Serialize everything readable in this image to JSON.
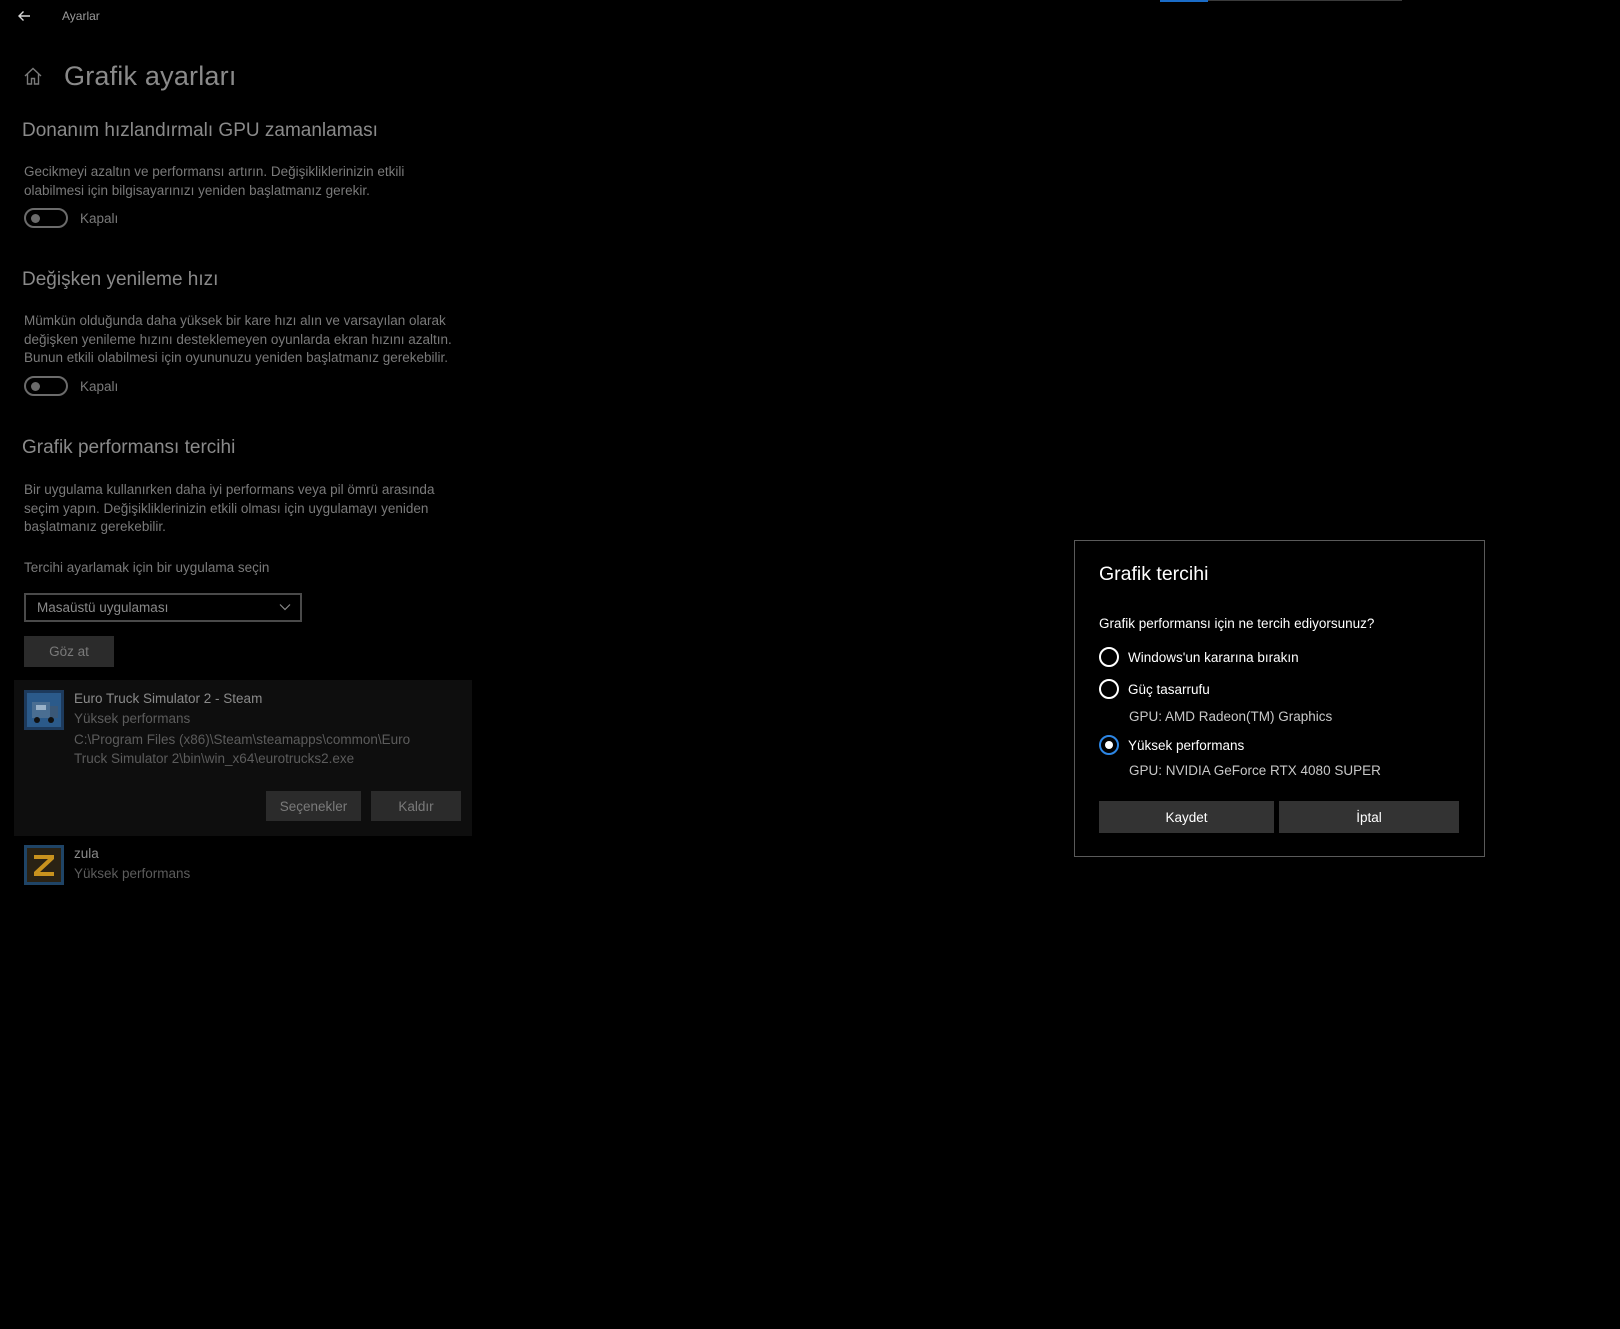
{
  "window": {
    "title": "Ayarlar",
    "back_icon": "arrow-left-icon"
  },
  "page": {
    "title": "Grafik ayarları",
    "home_icon": "home-icon"
  },
  "gpu_scheduling": {
    "title": "Donanım hızlandırmalı GPU zamanlaması",
    "description": "Gecikmeyi azaltın ve performansı artırın. Değişikliklerinizin etkili olabilmesi için bilgisayarınızı yeniden başlatmanız gerekir.",
    "toggle_state": "Kapalı"
  },
  "variable_refresh": {
    "title": "Değişken yenileme hızı",
    "description": "Mümkün olduğunda daha yüksek bir kare hızı alın ve varsayılan olarak değişken yenileme hızını desteklemeyen oyunlarda ekran hızını azaltın. Bunun etkili olabilmesi için oyununuzu yeniden başlatmanız gerekebilir.",
    "toggle_state": "Kapalı"
  },
  "graphics_preference": {
    "title": "Grafik performansı tercihi",
    "description": "Bir uygulama kullanırken daha iyi performans veya pil ömrü arasında seçim yapın. Değişikliklerinizin etkili olması için uygulamayı yeniden başlatmanız gerekebilir.",
    "select_label": "Tercihi ayarlamak için bir uygulama seçin",
    "select_value": "Masaüstü uygulaması",
    "browse_label": "Göz at"
  },
  "apps": [
    {
      "name": "Euro Truck Simulator 2 - Steam",
      "preference": "Yüksek performans",
      "path": "C:\\Program Files (x86)\\Steam\\steamapps\\common\\Euro Truck Simulator 2\\bin\\win_x64\\eurotrucks2.exe",
      "options_label": "Seçenekler",
      "remove_label": "Kaldır"
    },
    {
      "name": "zula",
      "preference": "Yüksek performans"
    }
  ],
  "dialog": {
    "title": "Grafik tercihi",
    "question": "Grafik performansı için ne tercih ediyorsunuz?",
    "options": [
      {
        "label": "Windows'un kararına bırakın",
        "checked": false
      },
      {
        "label": "Güç tasarrufu",
        "gpu": "GPU: AMD Radeon(TM) Graphics",
        "checked": false
      },
      {
        "label": "Yüksek performans",
        "gpu": "GPU: NVIDIA GeForce RTX 4080 SUPER",
        "checked": true
      }
    ],
    "save_label": "Kaydet",
    "cancel_label": "İptal"
  },
  "colors": {
    "background": "#000000",
    "accent": "#1a6cc7",
    "radio_checked": "#2d86e4",
    "dialog_button": "#333333"
  }
}
